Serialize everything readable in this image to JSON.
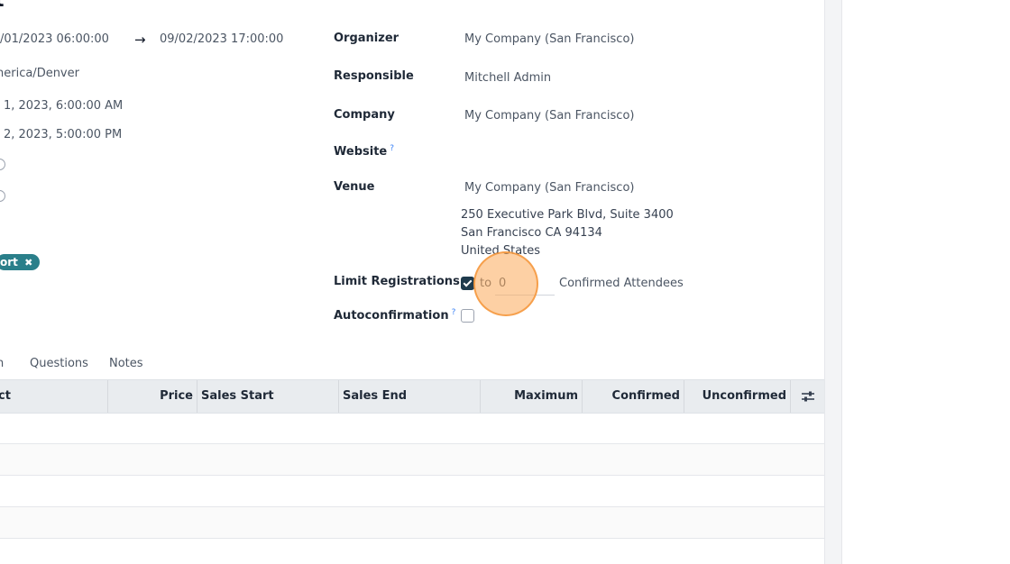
{
  "header": {
    "title_fragment": "t"
  },
  "left_fields": {
    "start_datetime": "/01/2023 06:00:00",
    "arrow": "→",
    "end_datetime": "09/02/2023 17:00:00",
    "timezone": "nerica/Denver",
    "date_begin_display": "1, 2023, 6:00:00 AM",
    "date_end_display": "2, 2023, 5:00:00 PM",
    "tag_label": "ort",
    "tag_remove": "✖"
  },
  "right_fields": {
    "organizer": {
      "label": "Organizer",
      "value": "My Company (San Francisco)"
    },
    "responsible": {
      "label": "Responsible",
      "value": "Mitchell Admin"
    },
    "company": {
      "label": "Company",
      "value": "My Company (San Francisco)"
    },
    "website": {
      "label": "Website",
      "help": "?"
    },
    "venue": {
      "label": "Venue",
      "value": "My Company (San Francisco)",
      "address_line1": "250 Executive Park Blvd, Suite 3400",
      "address_line2": "San Francisco CA 94134",
      "address_line3": "United States"
    },
    "limit_registrations": {
      "label": "Limit Registrations",
      "checked": true,
      "to_text": "to",
      "value": "0",
      "suffix": "Confirmed Attendees"
    },
    "autoconfirmation": {
      "label": "Autoconfirmation",
      "help": "?",
      "checked": false
    }
  },
  "tabs": [
    "n",
    "Questions",
    "Notes"
  ],
  "table": {
    "columns": [
      "ct",
      "Price",
      "Sales Start",
      "Sales End",
      "Maximum",
      "Confirmed",
      "Unconfirmed"
    ],
    "settings_icon": "sliders-icon",
    "rows": 4
  },
  "colors": {
    "tag_bg": "#2a7f8a",
    "checkbox_checked": "#1f3b4d",
    "highlight": "#f59a3c",
    "help_blue": "#3b82f6"
  }
}
